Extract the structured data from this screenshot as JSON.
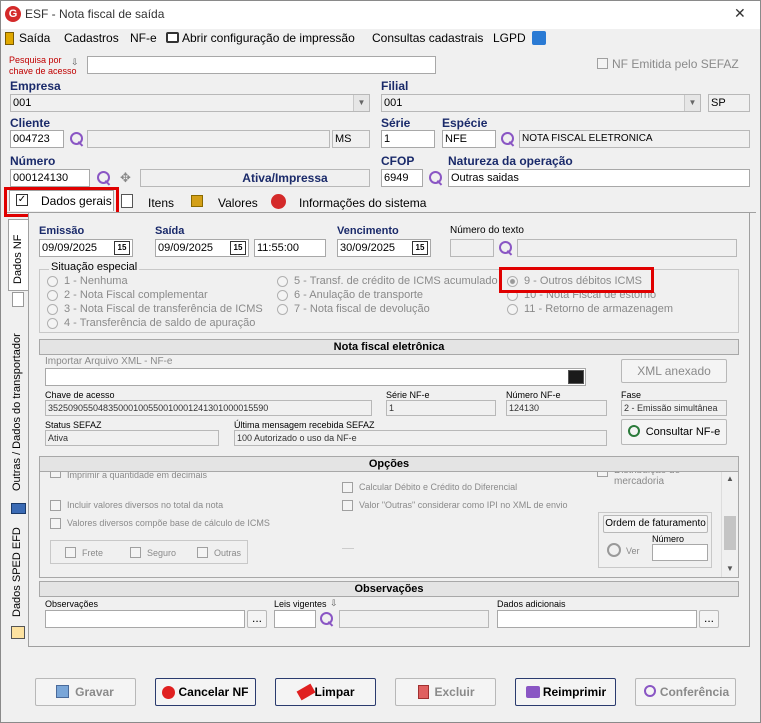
{
  "window": {
    "title": "ESF - Nota fiscal de saída",
    "close": "✕"
  },
  "menu": {
    "items": [
      "Saída",
      "Cadastros",
      "NF-e",
      "Abrir configuração de impressão",
      "Consultas cadastrais",
      "LGPD"
    ]
  },
  "search": {
    "label_line1": "Pesquisa por",
    "label_line2": "chave de acesso",
    "value": "",
    "nf_sefaz_label": "NF Emitida pelo SEFAZ"
  },
  "empresa": {
    "label": "Empresa",
    "value": "001"
  },
  "filial": {
    "label": "Filial",
    "value": "001",
    "uf": "SP"
  },
  "cliente": {
    "label": "Cliente",
    "code": "004723",
    "name": "",
    "uf": "MS"
  },
  "serie": {
    "label": "Série",
    "value": "1"
  },
  "especie": {
    "label": "Espécie",
    "code": "NFE",
    "desc": "NOTA FISCAL ELETRONICA"
  },
  "numero": {
    "label": "Número",
    "value": "000124130",
    "status": "Ativa/Impressa"
  },
  "cfop": {
    "label": "CFOP",
    "value": "6949"
  },
  "natureza": {
    "label": "Natureza da operação",
    "value": "Outras saidas"
  },
  "tabs": [
    "Dados gerais",
    "Itens",
    "Valores",
    "Informações do sistema"
  ],
  "side_tabs": [
    "Dados NF",
    "Outras / Dados do transportador",
    "Dados SPED EFD"
  ],
  "dates": {
    "emissao_label": "Emissão",
    "emissao": "09/09/2025",
    "saida_label": "Saída",
    "saida": "09/09/2025",
    "hora": "11:55:00",
    "vencimento_label": "Vencimento",
    "vencimento": "30/09/2025",
    "numero_texto_label": "Número do texto",
    "cal_icon": "15"
  },
  "situacao": {
    "title": "Situação especial",
    "options": [
      "1 - Nenhuma",
      "2 - Nota Fiscal complementar",
      "3 - Nota Fiscal de transferência de ICMS",
      "4 - Transferência de saldo de apuração",
      "5 - Transf. de crédito de ICMS acumulado",
      "6 - Anulação de transporte",
      "7 - Nota fiscal de devolução",
      "9 - Outros débitos ICMS",
      "10 - Nota Fiscal de estorno",
      "11 - Retorno de armazenagem"
    ]
  },
  "nfe": {
    "title": "Nota fiscal eletrônica",
    "importar_label": "Importar Arquivo XML - NF-e",
    "xml_button": "XML anexado",
    "chave_label": "Chave de acesso",
    "chave": "35250905504835000100550010001241301000015590",
    "serie_label": "Série NF-e",
    "serie": "1",
    "numero_label": "Número NF-e",
    "numero": "124130",
    "fase_label": "Fase",
    "fase": "2 - Emissão simultânea",
    "status_label": "Status SEFAZ",
    "status": "Ativa",
    "msg_label": "Última mensagem recebida SEFAZ",
    "msg": "100 Autorizado o uso da NF-e",
    "consultar_button": "Consultar NF-e"
  },
  "opcoes": {
    "title": "Opções",
    "left": [
      "Imprimir a quantidade em decimais",
      "Incluir valores diversos no total da nota",
      "Valores diversos compõe base de cálculo de ICMS"
    ],
    "sub": [
      "Frete",
      "Seguro",
      "Outras"
    ],
    "mid": [
      "Calcular Débito e Crédito do Diferencial",
      "Valor \"Outras\" considerar como IPI no XML de envio"
    ],
    "right": "Distribuição de mercadoria",
    "ordem_button": "Ordem de faturamento",
    "ordem_numero_label": "Número",
    "ver_label": "Ver"
  },
  "observacoes": {
    "title": "Observações",
    "obs_label": "Observações",
    "leis_label": "Leis vigentes",
    "dados_label": "Dados adicionais",
    "ellipsis": "..."
  },
  "buttons": {
    "gravar": "Gravar",
    "cancelar": "Cancelar NF",
    "limpar": "Limpar",
    "excluir": "Excluir",
    "reimprimir": "Reimprimir",
    "conferencia": "Conferência"
  },
  "colors": {
    "highlight": "#e00000",
    "accent_purple": "#8a56c4",
    "brand_red": "#d42a2a"
  }
}
